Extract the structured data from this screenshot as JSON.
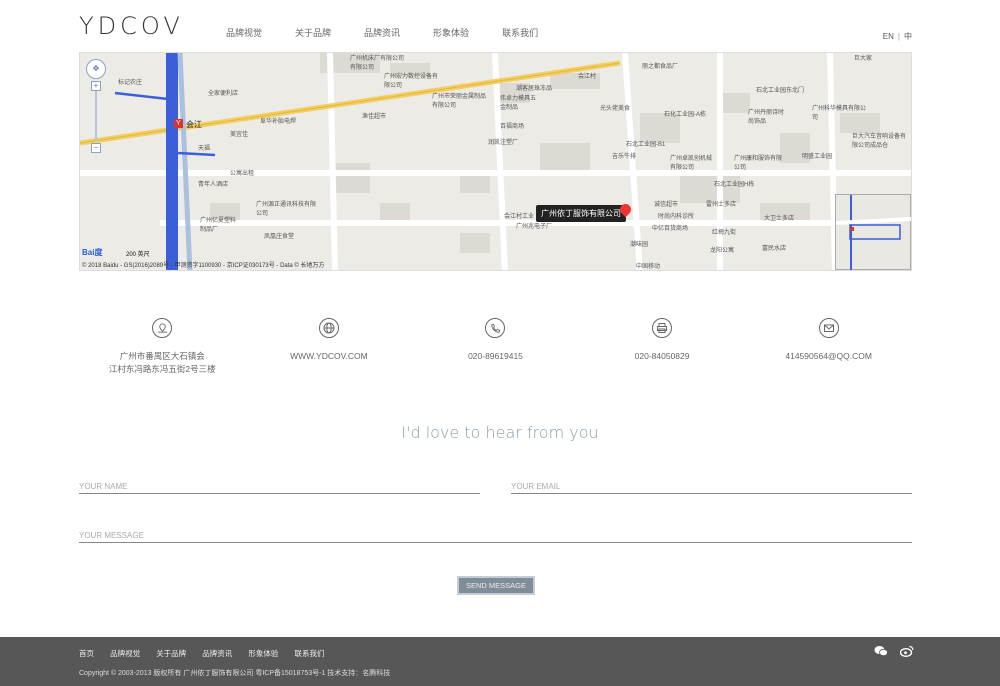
{
  "header": {
    "logo": "YDCOV",
    "nav": [
      "品牌视觉",
      "关于品牌",
      "品牌资讯",
      "形象体验",
      "联系我们"
    ],
    "lang_en": "EN",
    "lang_sep": "|",
    "lang_zh": "中"
  },
  "map": {
    "marker_label": "广州依丁服饰有限公司",
    "station": "会江",
    "scale": "200 英尺",
    "baidu": "Bai度",
    "copyright": "© 2018 Baidu - GS(2016)2089号 - 甲测资字1100930 - 京ICP证030173号 - Data © 长地万方",
    "labels": [
      "标记农庄",
      "全家便利店",
      "阜华补胎电焊",
      "美宜佳",
      "天福",
      "公寓出租",
      "青年人酒店",
      "广州源正通讯科技有限公司",
      "广州亿夏塑料制品厂",
      "凤凰庄食堂",
      "广州机床厂有限公司有限公司",
      "广州宏力数控设备有限公司",
      "广州市荣丽金属制品有限公司",
      "伟卓力模具五金制品",
      "渔佳超市",
      "潮客居珠冻品",
      "百福商场",
      "润凯注塑厂",
      "会江村工业",
      "广州兆电子厂",
      "会江村",
      "丽之都食品厂",
      "光头佬美食",
      "石化工业园-A栋",
      "广州丹丽诗时尚饰品",
      "石北工业园东北门",
      "广州科华模具有限公司",
      "石北工业园-B1",
      "吉乐牛排",
      "广州卓凯创机械有限公司",
      "广州康和服饰有限公司",
      "石北工业园H栋",
      "明盛工业园",
      "巨大汽车音响设备有限公司成品仓",
      "诚信超市",
      "时尚内科诊所",
      "中亿百货商场",
      "雷州士多店",
      "红梅九街",
      "大卫士多店",
      "潮味园",
      "龙阳公寓",
      "富民水店",
      "中国移动",
      "巨大家"
    ]
  },
  "contacts": [
    {
      "icon": "location-icon",
      "lines": [
        "广州市番禺区大石镇会",
        "江村东冯路东冯五街2号三楼"
      ]
    },
    {
      "icon": "globe-icon",
      "lines": [
        "WWW.YDCOV.COM"
      ]
    },
    {
      "icon": "phone-icon",
      "lines": [
        "020-89619415"
      ]
    },
    {
      "icon": "fax-icon",
      "lines": [
        "020-84050829"
      ]
    },
    {
      "icon": "email-icon",
      "lines": [
        "414590564@QQ.COM"
      ]
    }
  ],
  "form": {
    "title": "I'd love to hear from you",
    "name_placeholder": "YOUR NAME",
    "email_placeholder": "YOUR EMAIL",
    "message_placeholder": "YOUR MESSAGE",
    "send_label": "SEND MESSAGE"
  },
  "footer": {
    "nav": [
      "首页",
      "品牌视觉",
      "关于品牌",
      "品牌资讯",
      "形象体验",
      "联系我们"
    ],
    "copyright": "Copyright © 2003-2013 版权所有 广州依丁服饰有限公司 粤ICP备15018753号-1    技术支持：名腾科技",
    "icons": [
      "wechat-icon",
      "weibo-icon"
    ]
  }
}
